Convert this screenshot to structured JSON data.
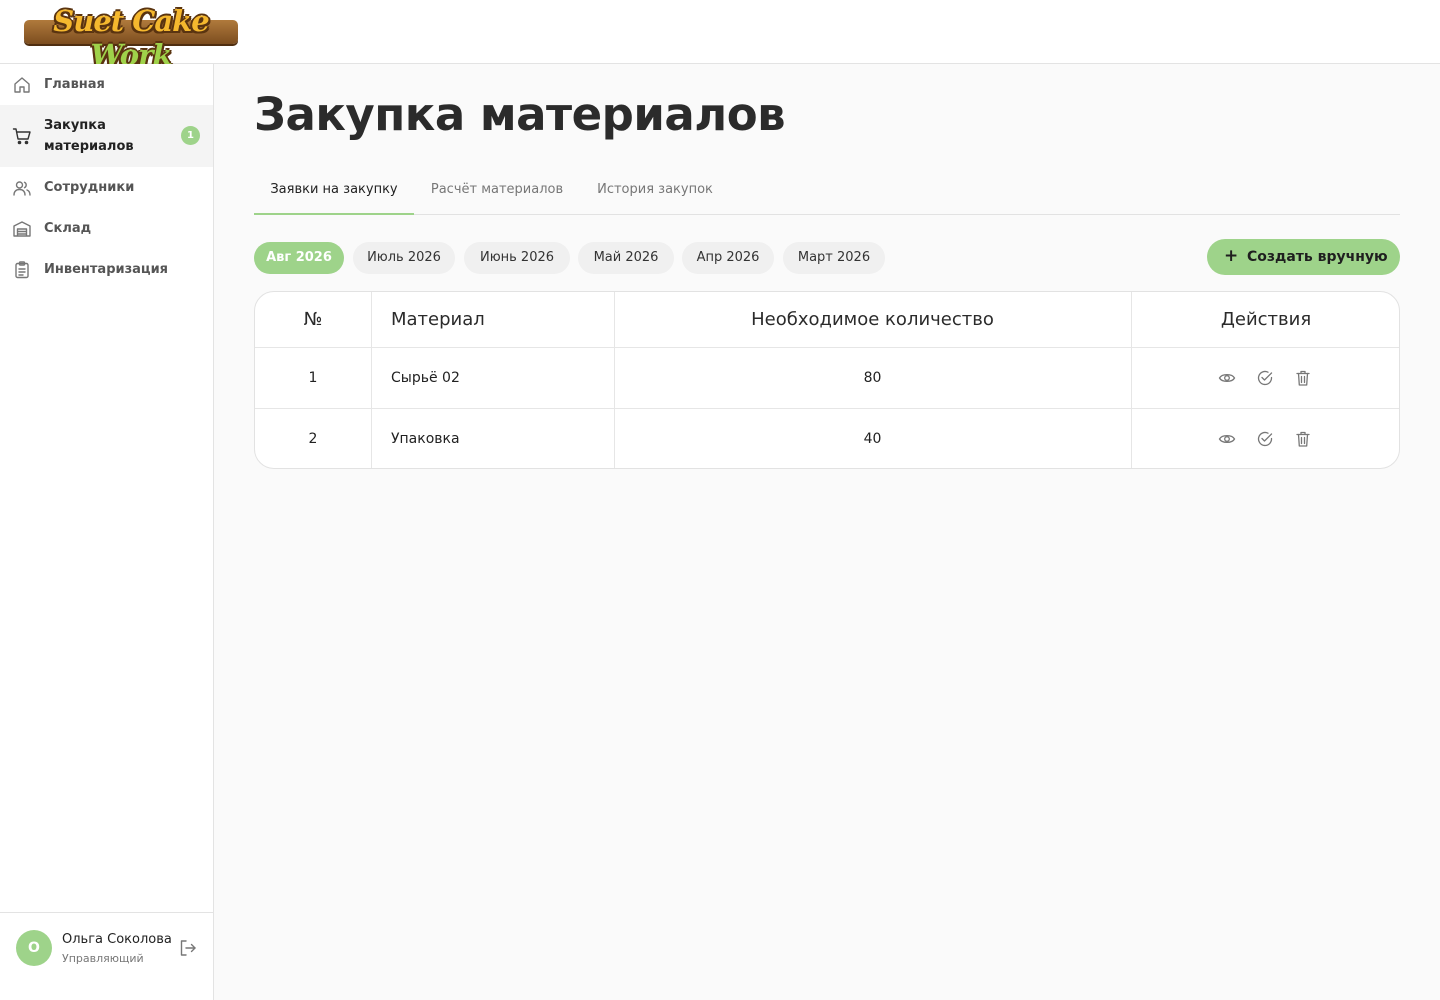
{
  "app": {
    "logo_text_a": "Suet Cake ",
    "logo_text_b": "Work"
  },
  "sidebar": {
    "items": [
      {
        "label": "Главная",
        "icon": "home-icon"
      },
      {
        "label": "Закупка материалов",
        "icon": "cart-icon",
        "badge": "1",
        "active": true
      },
      {
        "label": "Сотрудники",
        "icon": "users-icon"
      },
      {
        "label": "Склад",
        "icon": "warehouse-icon"
      },
      {
        "label": "Инвентаризация",
        "icon": "clipboard-icon"
      }
    ],
    "user": {
      "initial": "О",
      "name": "Ольга Соколова",
      "role": "Управляющий"
    }
  },
  "main": {
    "title": "Закупка материалов",
    "tabs": [
      {
        "label": "Заявки на закупку",
        "active": true
      },
      {
        "label": "Расчёт материалов"
      },
      {
        "label": "История закупок"
      }
    ],
    "months": [
      {
        "label": "Авг 2026",
        "active": true
      },
      {
        "label": "Июль 2026"
      },
      {
        "label": "Июнь 2026"
      },
      {
        "label": "Май 2026"
      },
      {
        "label": "Апр 2026"
      },
      {
        "label": "Март 2026"
      }
    ],
    "create_button": {
      "icon": "plus",
      "label": "Создать вручную"
    },
    "table": {
      "columns": [
        "№",
        "Материал",
        "Необходимое количество",
        "Действия"
      ],
      "rows": [
        {
          "num": "1",
          "material": "Сырьё 02",
          "qty": "80"
        },
        {
          "num": "2",
          "material": "Упаковка",
          "qty": "40"
        }
      ],
      "row_actions": [
        "eye-icon",
        "check-circle-icon",
        "trash-icon"
      ]
    }
  },
  "colors": {
    "accent": "#9ed38a",
    "text": "#2b2b2b",
    "muted": "#777777"
  }
}
